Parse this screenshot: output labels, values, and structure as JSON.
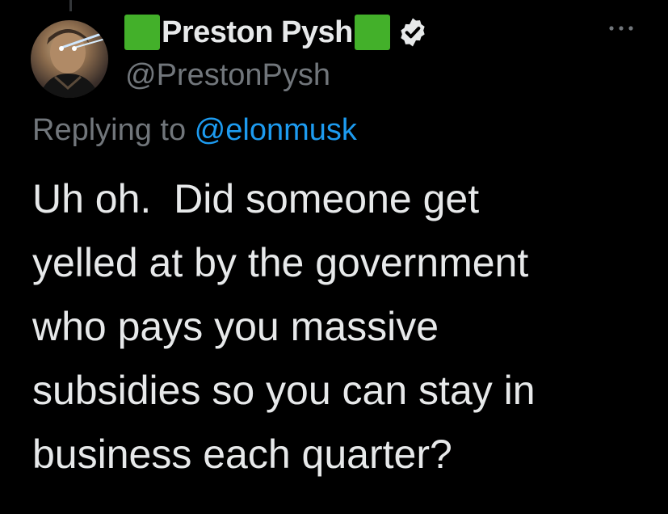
{
  "tweet": {
    "display_name": "Preston Pysh",
    "handle": "@PrestonPysh",
    "replying_prefix": "Replying to ",
    "replying_to": "@elonmusk",
    "text_lines": [
      "Uh oh.  Did someone get",
      "yelled at by the government",
      "who pays you massive",
      "subsidies so you can stay in",
      "business each quarter?"
    ],
    "icons": {
      "name_decoration": "green-square-icon",
      "verified": "verified-badge-icon",
      "more": "more-options-icon"
    }
  },
  "colors": {
    "background": "#000000",
    "primary_text": "#e7e9ea",
    "secondary_text": "#71767b",
    "link": "#1d9bf0",
    "green_square": "#43b02a"
  }
}
